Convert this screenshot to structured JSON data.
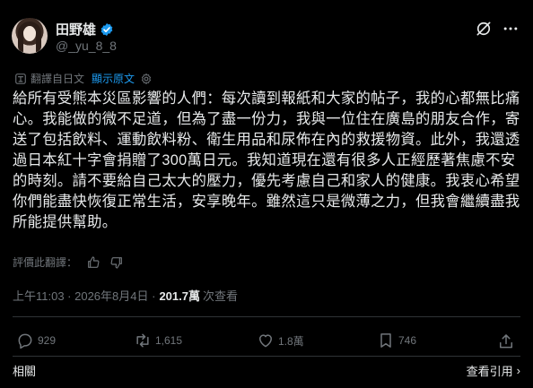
{
  "author": {
    "name": "田野雄",
    "handle": "@_yu_8_8"
  },
  "translation": {
    "label": "翻譯自日文",
    "show_original": "顯示原文"
  },
  "post": {
    "text": "給所有受熊本災區影響的人們：每次讀到報紙和大家的帖子，我的心都無比痛心。我能做的微不足道，但為了盡一份力，我與一位住在廣島的朋友合作，寄送了包括飲料、運動飲料粉、衛生用品和尿佈在內的救援物資。此外，我還透過日本紅十字會捐贈了300萬日元。我知道現在還有很多人正經歷著焦慮不安的時刻。請不要給自己太大的壓力，優先考慮自己和家人的健康。我衷心希望你們能盡快恢復正常生活，安享晚年。雖然這只是微薄之力，但我會繼續盡我所能提供幫助。"
  },
  "rate": {
    "label": "評價此翻譯："
  },
  "meta": {
    "timestamp": "上午11:03 · 2026年8月4日 ·",
    "views_count": "201.7萬",
    "views_label": "次查看"
  },
  "actions": {
    "replies": "929",
    "reposts": "1,615",
    "likes": "1.8萬",
    "bookmarks": "746"
  },
  "footer": {
    "related": "相關",
    "quotes": "查看引用"
  },
  "colors": {
    "background": "#000000",
    "text": "#e7e9ea",
    "muted": "#71767b",
    "accent": "#1d9bf0",
    "divider": "#2f3336"
  }
}
